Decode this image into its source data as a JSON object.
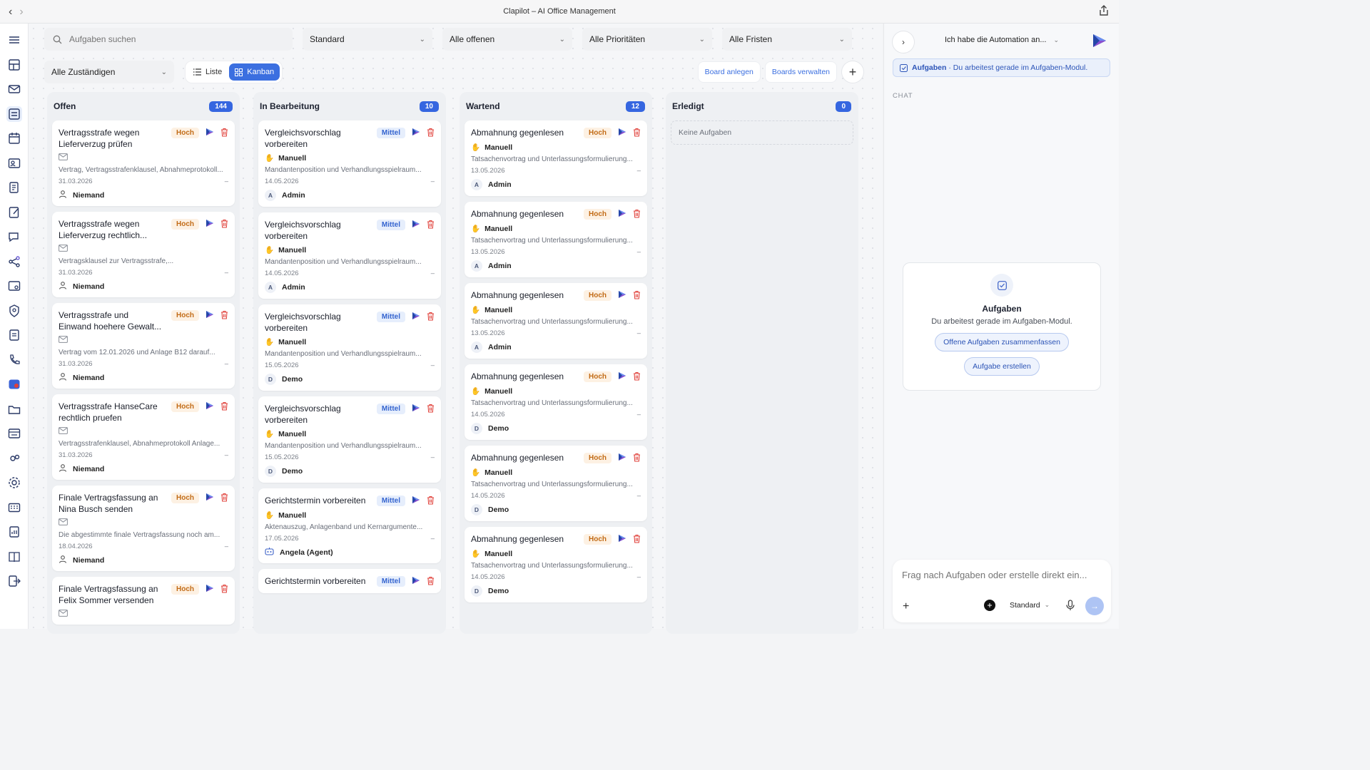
{
  "window": {
    "title": "Clapilot – AI Office Management"
  },
  "filters": {
    "search_placeholder": "Aufgaben suchen",
    "view": "Standard",
    "status": "Alle offenen",
    "priority": "Alle Prioritäten",
    "deadline": "Alle Fristen",
    "assignee": "Alle Zuständigen"
  },
  "view_toggle": {
    "list": "Liste",
    "kanban": "Kanban"
  },
  "actions": {
    "create_board": "Board anlegen",
    "manage_boards": "Boards verwalten"
  },
  "columns": [
    {
      "name": "Offen",
      "count": "144",
      "cards": [
        {
          "title": "Vertragsstrafe wegen Lieferverzug prüfen",
          "priority": "Hoch",
          "desc": "Vertrag, Vertragsstrafenklausel, Abnahmeprotokoll...",
          "date": "31.03.2026",
          "dash": "–",
          "assignee": "Niemand"
        },
        {
          "title": "Vertragsstrafe wegen Lieferverzug rechtlich...",
          "priority": "Hoch",
          "desc": "Vertragsklausel zur Vertragsstrafe,...",
          "date": "31.03.2026",
          "dash": "–",
          "assignee": "Niemand"
        },
        {
          "title": "Vertragsstrafe und Einwand hoehere Gewalt...",
          "priority": "Hoch",
          "desc": "Vertrag vom 12.01.2026 und Anlage B12 darauf...",
          "date": "31.03.2026",
          "dash": "–",
          "assignee": "Niemand"
        },
        {
          "title": "Vertragsstrafe HanseCare rechtlich pruefen",
          "priority": "Hoch",
          "desc": "Vertragsstrafenklausel, Abnahmeprotokoll Anlage...",
          "date": "31.03.2026",
          "dash": "–",
          "assignee": "Niemand"
        },
        {
          "title": "Finale Vertragsfassung an Nina Busch senden",
          "priority": "Hoch",
          "desc": "Die abgestimmte finale Vertragsfassung noch am...",
          "date": "18.04.2026",
          "dash": "–",
          "assignee": "Niemand"
        },
        {
          "title": "Finale Vertragsfassung an Felix Sommer versenden",
          "priority": "Hoch",
          "desc": "",
          "date": "",
          "dash": "",
          "assignee": ""
        }
      ]
    },
    {
      "name": "In Bearbeitung",
      "count": "10",
      "cards": [
        {
          "title": "Vergleichsvorschlag vorbereiten",
          "priority": "Mittel",
          "mode": "Manuell",
          "desc": "Mandantenposition und Verhandlungsspielraum...",
          "date": "14.05.2026",
          "dash": "–",
          "assignee": "Admin",
          "initial": "A"
        },
        {
          "title": "Vergleichsvorschlag vorbereiten",
          "priority": "Mittel",
          "mode": "Manuell",
          "desc": "Mandantenposition und Verhandlungsspielraum...",
          "date": "14.05.2026",
          "dash": "–",
          "assignee": "Admin",
          "initial": "A"
        },
        {
          "title": "Vergleichsvorschlag vorbereiten",
          "priority": "Mittel",
          "mode": "Manuell",
          "desc": "Mandantenposition und Verhandlungsspielraum...",
          "date": "15.05.2026",
          "dash": "–",
          "assignee": "Demo",
          "initial": "D"
        },
        {
          "title": "Vergleichsvorschlag vorbereiten",
          "priority": "Mittel",
          "mode": "Manuell",
          "desc": "Mandantenposition und Verhandlungsspielraum...",
          "date": "15.05.2026",
          "dash": "–",
          "assignee": "Demo",
          "initial": "D"
        },
        {
          "title": "Gerichtstermin vorbereiten",
          "priority": "Mittel",
          "mode": "Manuell",
          "desc": "Aktenauszug, Anlagenband und Kernargumente...",
          "date": "17.05.2026",
          "dash": "–",
          "assignee": "Angela (Agent)",
          "initial": ""
        },
        {
          "title": "Gerichtstermin vorbereiten",
          "priority": "Mittel",
          "mode": "",
          "desc": "",
          "date": "",
          "dash": "",
          "assignee": "",
          "initial": ""
        }
      ]
    },
    {
      "name": "Wartend",
      "count": "12",
      "cards": [
        {
          "title": "Abmahnung gegenlesen",
          "priority": "Hoch",
          "mode": "Manuell",
          "desc": "Tatsachenvortrag und Unterlassungsformulierung...",
          "date": "13.05.2026",
          "dash": "–",
          "assignee": "Admin",
          "initial": "A"
        },
        {
          "title": "Abmahnung gegenlesen",
          "priority": "Hoch",
          "mode": "Manuell",
          "desc": "Tatsachenvortrag und Unterlassungsformulierung...",
          "date": "13.05.2026",
          "dash": "–",
          "assignee": "Admin",
          "initial": "A"
        },
        {
          "title": "Abmahnung gegenlesen",
          "priority": "Hoch",
          "mode": "Manuell",
          "desc": "Tatsachenvortrag und Unterlassungsformulierung...",
          "date": "13.05.2026",
          "dash": "–",
          "assignee": "Admin",
          "initial": "A"
        },
        {
          "title": "Abmahnung gegenlesen",
          "priority": "Hoch",
          "mode": "Manuell",
          "desc": "Tatsachenvortrag und Unterlassungsformulierung...",
          "date": "14.05.2026",
          "dash": "–",
          "assignee": "Demo",
          "initial": "D"
        },
        {
          "title": "Abmahnung gegenlesen",
          "priority": "Hoch",
          "mode": "Manuell",
          "desc": "Tatsachenvortrag und Unterlassungsformulierung...",
          "date": "14.05.2026",
          "dash": "–",
          "assignee": "Demo",
          "initial": "D"
        },
        {
          "title": "Abmahnung gegenlesen",
          "priority": "Hoch",
          "mode": "Manuell",
          "desc": "Tatsachenvortrag und Unterlassungsformulierung...",
          "date": "14.05.2026",
          "dash": "–",
          "assignee": "Demo",
          "initial": "D"
        }
      ]
    },
    {
      "name": "Erledigt",
      "count": "0",
      "empty": "Keine Aufgaben",
      "cards": []
    }
  ],
  "panel": {
    "thread_title": "Ich habe die Automation an...",
    "context_module": "Aufgaben",
    "context_text": " · Du arbeitest gerade im Aufgaben-Modul.",
    "chat_label": "CHAT",
    "welcome_title": "Aufgaben",
    "welcome_sub": "Du arbeitest gerade im Aufgaben-Modul.",
    "suggestion_1": "Offene Aufgaben zusammenfassen",
    "suggestion_2": "Aufgabe erstellen",
    "input_placeholder": "Frag nach Aufgaben oder erstelle direkt ein...",
    "model": "Standard"
  },
  "sidebar_icons": [
    "menu-icon",
    "dashboard-icon",
    "mail-icon",
    "tasks-icon",
    "calendar-icon",
    "contacts-icon",
    "documents-icon",
    "notes-icon",
    "chat-icon",
    "workflow-icon",
    "settings-panel-icon",
    "shield-icon",
    "invoice-icon",
    "phone-icon",
    "media-icon",
    "folder-icon",
    "browser-icon",
    "automation-icon",
    "gear-icon",
    "keyboard-icon",
    "report-icon",
    "book-icon",
    "logout-icon"
  ],
  "colors": {
    "accent": "#3566e0",
    "hoch_bg": "#fdf1e3",
    "hoch_text": "#c26b16",
    "mittel_bg": "#e6eefc",
    "mittel_text": "#3464cf",
    "delete": "#e0403a"
  }
}
